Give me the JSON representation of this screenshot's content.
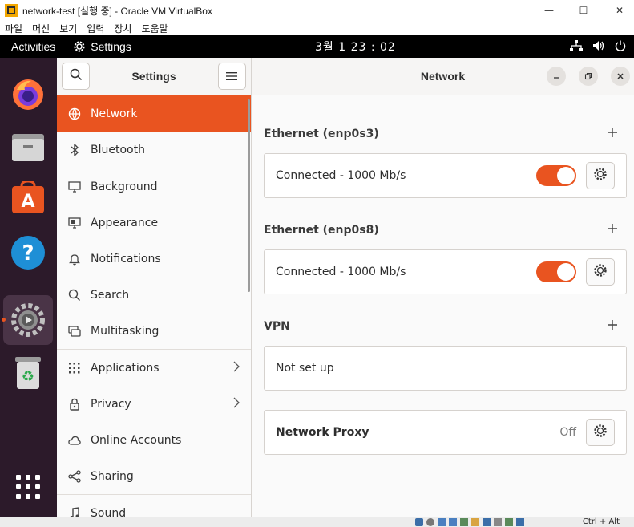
{
  "host": {
    "title": "network-test [실행 중] - Oracle VM VirtualBox",
    "menus": [
      "파일",
      "머신",
      "보기",
      "입력",
      "장치",
      "도움말"
    ],
    "controls": [
      "—",
      "☐",
      "✕"
    ],
    "host_key": "Ctrl + Alt"
  },
  "topbar": {
    "activities": "Activities",
    "app_name": "Settings",
    "clock": "3월 1  23 : 02"
  },
  "dock": {
    "items": [
      "firefox-icon",
      "files-icon",
      "app-center-icon",
      "help-icon",
      "settings-icon",
      "trash-icon",
      "app-grid-icon"
    ]
  },
  "sidebar": {
    "title": "Settings",
    "items": [
      {
        "label": "Network",
        "icon": "network-icon",
        "active": true
      },
      {
        "label": "Bluetooth",
        "icon": "bluetooth-icon"
      },
      {
        "label": "Background",
        "icon": "background-icon"
      },
      {
        "label": "Appearance",
        "icon": "appearance-icon"
      },
      {
        "label": "Notifications",
        "icon": "bell-icon"
      },
      {
        "label": "Search",
        "icon": "search-icon"
      },
      {
        "label": "Multitasking",
        "icon": "multitasking-icon"
      },
      {
        "label": "Applications",
        "icon": "grid-icon",
        "chevron": true
      },
      {
        "label": "Privacy",
        "icon": "lock-icon",
        "chevron": true
      },
      {
        "label": "Online Accounts",
        "icon": "cloud-icon"
      },
      {
        "label": "Sharing",
        "icon": "share-icon"
      },
      {
        "label": "Sound",
        "icon": "music-icon"
      }
    ]
  },
  "main": {
    "title": "Network",
    "sections": [
      {
        "heading": "Ethernet (enp0s3)",
        "status": "Connected - 1000 Mb/s",
        "toggle_on": true
      },
      {
        "heading": "Ethernet (enp0s8)",
        "status": "Connected - 1000 Mb/s",
        "toggle_on": true
      },
      {
        "heading": "VPN",
        "status": "Not set up"
      }
    ],
    "proxy": {
      "label": "Network Proxy",
      "value": "Off"
    }
  },
  "colors": {
    "accent": "#e95420",
    "dock_bg": "#2c1a2a",
    "topbar_bg": "#000000"
  }
}
